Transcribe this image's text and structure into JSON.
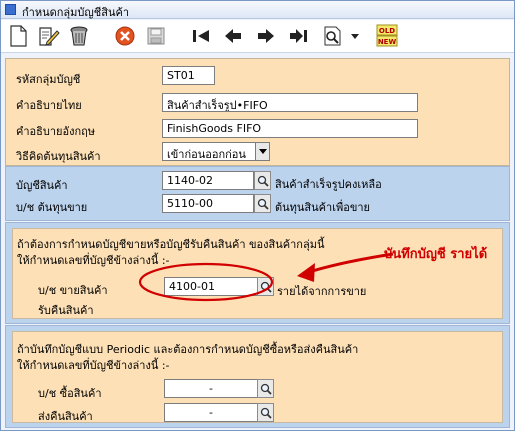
{
  "window": {
    "title": "กำหนดกลุ่มบัญชีสินค้า"
  },
  "toolbar": {
    "buttons": [
      "new-icon",
      "edit-icon",
      "delete-icon",
      "cancel-icon",
      "save-icon",
      "first-icon",
      "previous-icon",
      "next-icon",
      "last-icon",
      "find-icon",
      "dropdown-icon",
      "old-new-icon"
    ],
    "old_new_top": "OLD",
    "old_new_bottom": "NEW"
  },
  "general": {
    "group_code_label": "รหัสกลุ่มบัญชี",
    "group_code_value": "ST01",
    "desc_thai_label": "คำอธิบายไทย",
    "desc_thai_value": "สินค้าสำเร็จรูป•FIFO",
    "desc_eng_label": "คำอธิบายอังกฤษ",
    "desc_eng_value": "FinishGoods FIFO",
    "cost_method_label": "วิธีคิดต้นทุนสินค้า",
    "cost_method_value": "เข้าก่อนออกก่อน"
  },
  "accounts": {
    "inventory_label": "บัญชีสินค้า",
    "inventory_code": "1140-02",
    "inventory_desc": "สินค้าสำเร็จรูปคงเหลือ",
    "cogs_label": "บ/ช ต้นทุนขาย",
    "cogs_code": "5110-00",
    "cogs_desc": "ต้นทุนสินค้าเพื่อขาย"
  },
  "sales_section": {
    "note_line1": "ถ้าต้องการกำหนดบัญชีขายหรือบัญชีรับคืนสินค้า ของสินค้ากลุ่มนี้",
    "note_line2": "ให้กำหนดเลขที่บัญชีข้างล่างนี้ :-",
    "sales_label": "บ/ช ขายสินค้า",
    "sales_code": "4100-01",
    "sales_desc": "รายได้จากการขาย",
    "return_label": "รับคืนสินค้า"
  },
  "periodic_section": {
    "note_line1": "ถ้าบันทึกบัญชีแบบ Periodic และต้องการกำหนดบัญชีซื้อหรือส่งคืนสินค้า",
    "note_line2": "ให้กำหนดเลขที่บัญชีข้างล่างนี้ :-",
    "purchase_label": "บ/ช ซื้อสินค้า",
    "purchase_code": "-",
    "return_label": "ส่งคืนสินค้า",
    "return_code": "-"
  },
  "annotation": {
    "text": "บันทึกบัญชี รายได้",
    "color": "#d00000"
  }
}
